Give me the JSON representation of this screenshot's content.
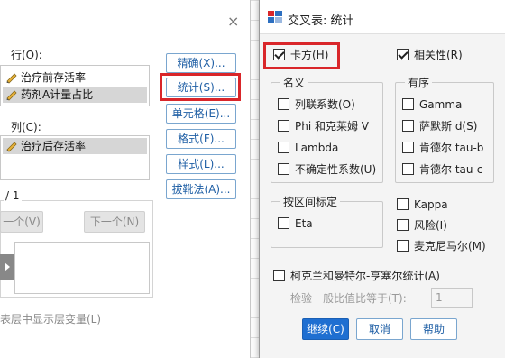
{
  "left_dialog": {
    "close_icon": "×",
    "rows_label": "行(O):",
    "rows_items": [
      "治疗前存活率",
      "药剂A计量占比"
    ],
    "cols_label": "列(C):",
    "cols_items": [
      "治疗后存活率"
    ],
    "layer_counter": "/ 1",
    "prev_label": "一个(V)",
    "next_label": "下一个(N)",
    "display_layer_label": "表层中显示层变量(L)",
    "side_buttons": [
      "精确(X)...",
      "统计(S)...",
      "单元格(E)...",
      "格式(F)...",
      "样式(L)...",
      "拔靴法(A)..."
    ]
  },
  "stats_dialog": {
    "title": "交叉表: 统计",
    "chi_square": "卡方(H)",
    "correlation": "相关性(R)",
    "nominal": {
      "title": "名义",
      "items": [
        "列联系数(O)",
        "Phi 和克莱姆 V",
        "Lambda",
        "不确定性系数(U)"
      ]
    },
    "ordinal": {
      "title": "有序",
      "items": [
        "Gamma",
        "萨默斯 d(S)",
        "肯德尔 tau-b",
        "肯德尔 tau-c"
      ]
    },
    "interval": {
      "title": "按区间标定",
      "items": [
        "Eta"
      ]
    },
    "other_items": [
      "Kappa",
      "风险(I)",
      "麦克尼马尔(M)"
    ],
    "cmh": "柯克兰和曼特尔-亨塞尔统计(A)",
    "test_ratio_label": "检验一般比值比等于(T):",
    "test_ratio_value": "1",
    "buttons": {
      "continue": "继续(C)",
      "cancel": "取消",
      "help": "帮助"
    },
    "checked": {
      "chi_square": true,
      "correlation": true
    }
  },
  "colors": {
    "highlight": "#d9262a",
    "primary": "#1f6fd1"
  }
}
